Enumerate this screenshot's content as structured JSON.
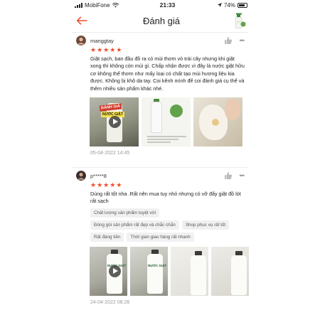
{
  "status_bar": {
    "carrier": "MobiFone",
    "time": "21:33",
    "battery": "74%"
  },
  "header": {
    "title": "Đánh giá"
  },
  "reviews": [
    {
      "username": "manggtay",
      "stars": 5,
      "text": "Giặt sạch, ban đầu đồ ra có mùi thơm vỏ trái cây nhưng khi giặt xong thì không còn mùi gì. Chấp nhận được vì đây là nước giặt hữu cơ không thể thơm như mấy loại có chất tạo mùi hương liệu kia được. Không bị khô da tay. Coi kênh mình để coi đánh giá cụ thể và thêm nhiều sản phẩm khác nhé.",
      "media_label_1": "ĐÁNH GIÁ",
      "media_label_2": "NƯỚC GIẶT",
      "date": "05-04-2022 14:45"
    },
    {
      "username": "p*****8",
      "stars": 5,
      "text": "Dùng rất tốt nha .Rất nên mua tuy nhỏ nhưng có vỡ đấy giặt đồ lót rất sạch",
      "tags": [
        "Chất lượng sản phẩm tuyệt vời",
        "Đóng gói sản phẩm rất đẹp và chắc chắn",
        "Shop phục vụ rất tốt",
        "Rất đáng tiền",
        "Thời gian giao hàng rất nhanh"
      ],
      "media_label": "NƯỚC GIẶT",
      "date": "24-04-2022 08:26"
    }
  ],
  "colors": {
    "accent": "#ee4d2d",
    "tag_bg": "#f1f1f1",
    "muted": "#999999"
  },
  "icons": {
    "back": "arrow-left-icon",
    "like": "thumbs-up-icon",
    "more": "more-dots-icon",
    "play": "play-icon"
  }
}
